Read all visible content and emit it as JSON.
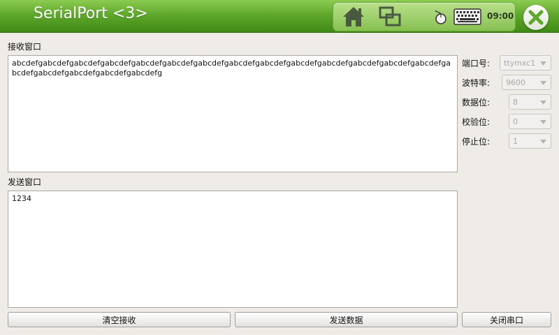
{
  "app": {
    "title": "SerialPort <3>"
  },
  "toolbar": {
    "icons": [
      "home-icon",
      "windows-icon",
      "mouse-icon",
      "keyboard-icon",
      "close-icon"
    ],
    "clock": "09:00",
    "accent": "#5fa82c"
  },
  "receive": {
    "label": "接收窗口",
    "text": "abcdefgabcdefgabcdefgabcdefgabcdefgabcdefgabcdefgabcdefgabcdefgabcdefgabcdefgabcdefgabcdefgabcdefgabcdefgabcdefgabcdefgabcdefgabcdefg"
  },
  "send": {
    "label": "发送窗口",
    "text": "1234"
  },
  "settings": {
    "port_label": "端口号:",
    "port_value": "ttymxc1",
    "baud_label": "波特率:",
    "baud_value": "9600",
    "databits_label": "数据位:",
    "databits_value": "8",
    "parity_label": "校验位:",
    "parity_value": "0",
    "stopbits_label": "停止位:",
    "stopbits_value": "1"
  },
  "buttons": {
    "clear_receive": "清空接收",
    "send_data": "发送数据",
    "close_port": "关闭串口"
  }
}
